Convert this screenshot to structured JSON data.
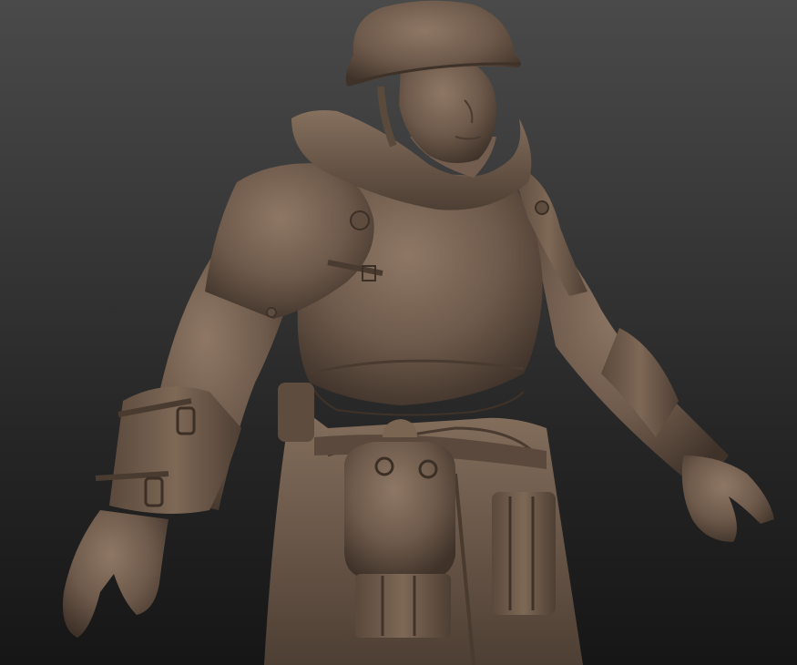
{
  "scene": {
    "subject": "soldier-sculpt",
    "colors": {
      "clay": "#6e5a4b",
      "clay_light": "#8b7462",
      "clay_dark": "#4a3b30",
      "background_top": "#4a4a4a",
      "background_bottom": "#161616"
    }
  }
}
